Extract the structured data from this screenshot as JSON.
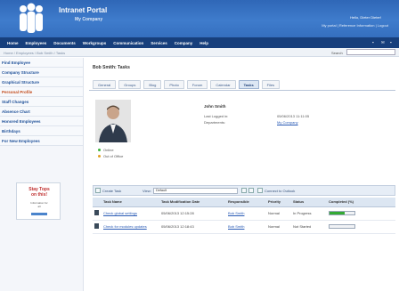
{
  "header": {
    "title": "Intranet Portal",
    "company": "My Company",
    "greeting": "Hello, Dieter Dieter!",
    "links": "My portal  |  Reference Information  |  Logout"
  },
  "menu": {
    "items": [
      "Home",
      "Employees",
      "Documents",
      "Workgroups",
      "Communication",
      "Services",
      "Company",
      "Help"
    ]
  },
  "breadcrumb": "Home / Employees / Bob Smith / Tasks",
  "search": {
    "label": "Search",
    "value": ""
  },
  "leftnav": {
    "items": [
      {
        "label": "Find Employee",
        "active": false
      },
      {
        "label": "Company Structure",
        "active": false
      },
      {
        "label": "Graphical Structure",
        "active": false
      },
      {
        "label": "Personal Profile",
        "active": true
      },
      {
        "label": "Staff Changes",
        "active": false
      },
      {
        "label": "Absence Chart",
        "active": false
      },
      {
        "label": "Honored Employees",
        "active": false
      },
      {
        "label": "Birthdays",
        "active": false
      },
      {
        "label": "For New Employees",
        "active": false
      }
    ],
    "ad_title": "Stay Tops on this!",
    "ad_text": "Information for all"
  },
  "main": {
    "title": "Bob Smith: Tasks",
    "tabs": [
      {
        "label": "General",
        "active": false
      },
      {
        "label": "Groups",
        "active": false
      },
      {
        "label": "Blog",
        "active": false
      },
      {
        "label": "Photo",
        "active": false
      },
      {
        "label": "Forum",
        "active": false
      },
      {
        "label": "Calendar",
        "active": false
      },
      {
        "label": "Tasks",
        "active": true
      },
      {
        "label": "Files",
        "active": false
      }
    ]
  },
  "profile": {
    "name": "John Smith",
    "last_logged_in_label": "Last Logged in:",
    "last_logged_in_value": "05/06/2013 11:11:05",
    "departments_label": "Departments:",
    "departments_value": "My Company",
    "status_online": "Online",
    "status_out": "Out of Office"
  },
  "toolbar": {
    "create_task": "Create Task",
    "view_label": "View:",
    "view_value": "Default",
    "outlook": "Connect to Outlook"
  },
  "tasks": {
    "columns": [
      "Task Name",
      "Task Modification Date",
      "Responsible",
      "Priority",
      "Status",
      "Completed (%)"
    ],
    "rows": [
      {
        "name": "Check global settings",
        "date": "05/06/2013 12:15:28",
        "responsible": "Bob Smith",
        "priority": "Normal",
        "status": "In Progress",
        "completed": 60
      },
      {
        "name": "Check for modules updates",
        "date": "05/06/2013 12:18:43",
        "responsible": "Bob Smith",
        "priority": "Normal",
        "status": "Not Started",
        "completed": 0
      }
    ]
  },
  "colors": {
    "header_blue": "#3570c0",
    "menu_navy": "#173f7c",
    "active_orange": "#c24a1a",
    "link_blue": "#2a5bb5",
    "progress_green": "#33aa33"
  }
}
